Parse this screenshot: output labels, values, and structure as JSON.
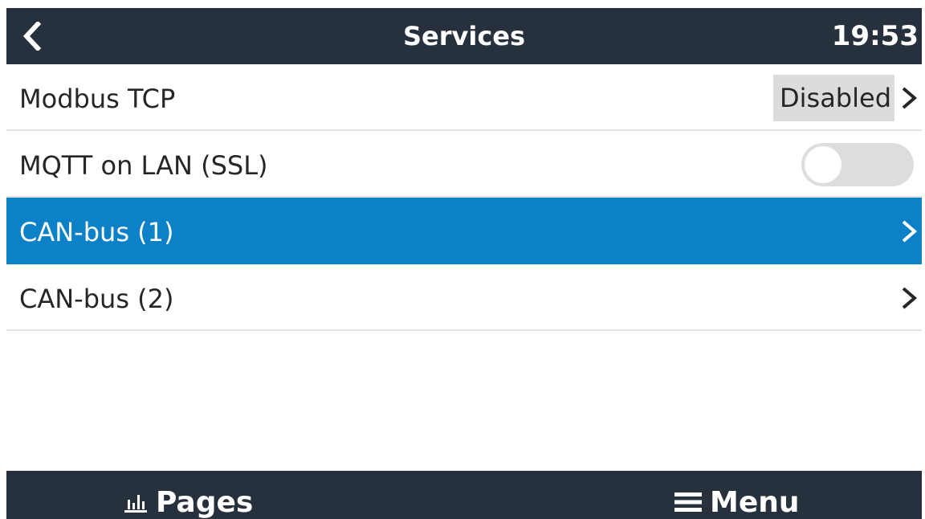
{
  "header": {
    "title": "Services",
    "time": "19:53",
    "back_icon": "chevron-left-icon"
  },
  "services": {
    "modbus": {
      "label": "Modbus TCP",
      "value": "Disabled"
    },
    "mqtt": {
      "label": "MQTT on LAN (SSL)",
      "toggle_on": false
    },
    "canbus1": {
      "label": "CAN-bus (1)",
      "selected": true
    },
    "canbus2": {
      "label": "CAN-bus (2)"
    }
  },
  "footer": {
    "pages_label": "Pages",
    "pages_icon": "bar-chart-icon",
    "menu_label": "Menu",
    "menu_icon": "hamburger-menu-icon"
  },
  "colors": {
    "header_bg": "#27313e",
    "selected_bg": "#0c81c8",
    "value_bg": "#dcdcdc",
    "toggle_off": "#dddddd"
  }
}
